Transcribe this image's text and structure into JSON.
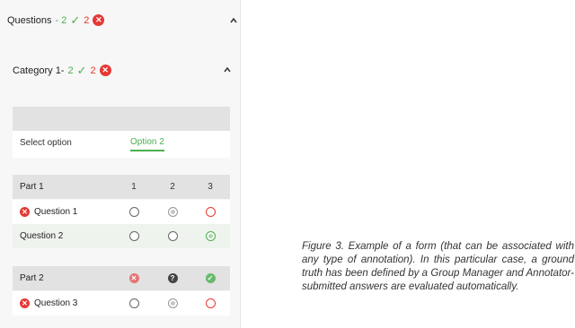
{
  "questions_header": {
    "label": "Questions",
    "prefix": "- 2",
    "correct_count": "2",
    "correct_icon": "check-icon",
    "wrong_count": "2",
    "wrong_icon": "x-circle-icon",
    "collapse_icon": "chevron-up-icon"
  },
  "category_header": {
    "label": "Category 1-",
    "correct_count": "2",
    "wrong_count": "2",
    "collapse_icon": "chevron-up-icon"
  },
  "select": {
    "label": "Select option",
    "value": "Option 2"
  },
  "part1": {
    "label": "Part 1",
    "columns": [
      "1",
      "2",
      "3"
    ],
    "rows": [
      {
        "label": "Question 1",
        "status": "wrong"
      },
      {
        "label": "Question 2",
        "status": "none"
      }
    ]
  },
  "part2": {
    "label": "Part 2",
    "column_status_icons": [
      "x-circle-icon",
      "question-circle-icon",
      "check-circle-icon"
    ],
    "rows": [
      {
        "label": "Question 3",
        "status": "wrong"
      }
    ]
  },
  "caption": "Figure 3. Example of a form (that can be associated with any type of annotation). In this particular case, a ground truth has been defined by a Group Manager and Annotator-submitted answers are evaluated automatically.",
  "colors": {
    "correct": "#4caf50",
    "wrong": "#e53935",
    "panel_bg": "#f7f7f7",
    "header_bg": "#e2e2e2"
  }
}
